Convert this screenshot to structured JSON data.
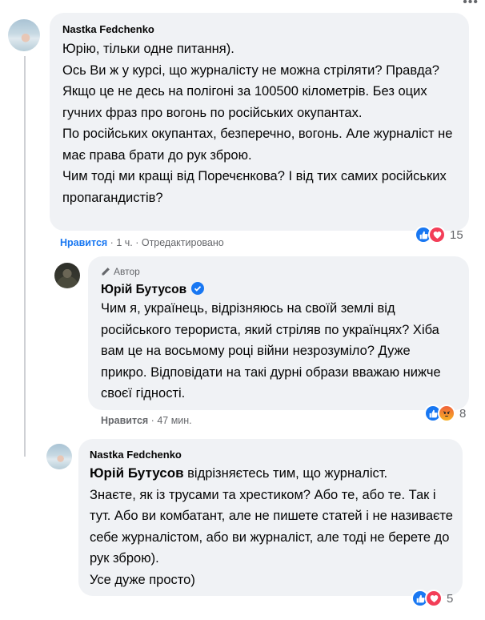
{
  "comments": [
    {
      "author": "Nastka Fedchenko",
      "text": "Юрію, тільки одне питання).\nОсь Ви ж у курсі, що журналісту не можна стріляти? Правда? Якщо це не десь на полігоні за 100500 кілометрів. Без оцих гучних фраз про вогонь по російських окупантах.\nПо російських окупантах, безперечно, вогонь. Але журналіст не має права брати до рук зброю.\nЧим тоді ми кращі від Поречєнкова? І від тих самих російських пропагандистів?",
      "like_label": "Нравится",
      "time": "1 ч.",
      "edited": "Отредактировано",
      "reactions": [
        "like-icon",
        "love-icon"
      ],
      "reaction_count": "15"
    },
    {
      "author_badge": "Автор",
      "author": "Юрій Бутусов",
      "text": "Чим я, українець, відрізняюсь на своїй землі від російського терориста, який стріляв по українцях? Хіба вам це на восьмому році війни незрозуміло? Дуже прикро. Відповідати на такі дурні образи вважаю нижче своєї гідності.",
      "like_label": "Нравится",
      "time": "47 мин.",
      "reactions": [
        "like-icon",
        "angry-icon"
      ],
      "reaction_count": "8"
    },
    {
      "author": "Nastka Fedchenko",
      "mention": "Юрій Бутусов",
      "text_after_mention": " відрізняєтесь тим, що журналіст.\nЗнаєте, як із трусами та хрестиком? Або те, або те. Так і тут. Або ви комбатант, але не пишете статей і не називаєте себе журналістом, або ви журналіст, але тоді не берете до рук зброю).\nУсе дуже просто)",
      "reactions": [
        "like-icon",
        "love-icon"
      ],
      "reaction_count": "5"
    }
  ],
  "colors": {
    "bubble": "#f0f2f5",
    "like_blue": "#1877f2",
    "meta_gray": "#65676b"
  },
  "more_icon": "more-options-icon"
}
